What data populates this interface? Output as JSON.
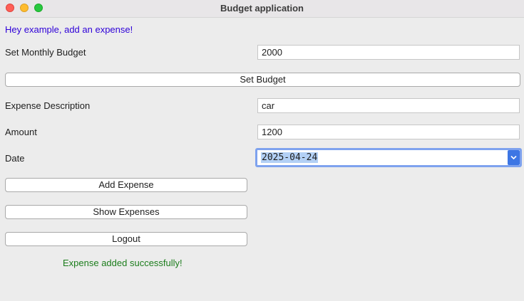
{
  "window": {
    "title": "Budget application"
  },
  "greeting": "Hey example, add an expense!",
  "budget": {
    "label": "Set Monthly Budget",
    "value": "2000",
    "button": "Set Budget"
  },
  "expense": {
    "description_label": "Expense Description",
    "description_value": "car",
    "amount_label": "Amount",
    "amount_value": "1200",
    "date_label": "Date",
    "date_value": "2025-04-24"
  },
  "actions": {
    "add": "Add Expense",
    "show": "Show Expenses",
    "logout": "Logout"
  },
  "status": {
    "message": "Expense added successfully!"
  },
  "colors": {
    "greeting": "#2e00d8",
    "success": "#1c7d1c",
    "focus_ring": "#7ea2ee",
    "dropdown_button": "#3d76e4"
  },
  "icons": {
    "close": "close-icon",
    "minimize": "minimize-icon",
    "maximize": "maximize-icon",
    "date_dropdown": "chevron-down-icon"
  }
}
